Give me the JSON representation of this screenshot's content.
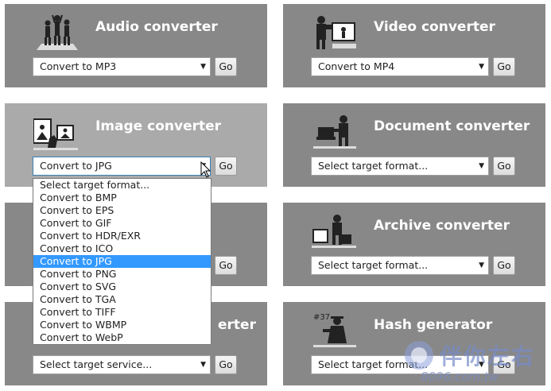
{
  "cards": [
    {
      "title": "Audio converter",
      "select": "Convert to MP3",
      "go": "Go",
      "icon": "musicians-icon"
    },
    {
      "title": "Video converter",
      "select": "Convert to MP4",
      "go": "Go",
      "icon": "video-camera-icon"
    },
    {
      "title": "Image converter",
      "select": "Convert to JPG",
      "go": "Go",
      "icon": "image-photographer-icon"
    },
    {
      "title": "Document converter",
      "select": "Select target format...",
      "go": "Go",
      "icon": "document-writer-icon"
    },
    {
      "title": "",
      "select": "",
      "go": "Go",
      "icon": ""
    },
    {
      "title": "Archive converter",
      "select": "Select target format...",
      "go": "Go",
      "icon": "archive-crate-icon"
    },
    {
      "title": "erter",
      "select": "Select target service...",
      "go": "Go",
      "icon": ""
    },
    {
      "title": "Hash generator",
      "select": "Select target format...",
      "go": "Go",
      "icon": "hash-detective-icon"
    }
  ],
  "dropdown": {
    "options": [
      "Select target format...",
      "Convert to BMP",
      "Convert to EPS",
      "Convert to GIF",
      "Convert to HDR/EXR",
      "Convert to ICO",
      "Convert to JPG",
      "Convert to PNG",
      "Convert to SVG",
      "Convert to TGA",
      "Convert to TIFF",
      "Convert to WBMP",
      "Convert to WebP"
    ],
    "selected": "Convert to JPG"
  },
  "watermark": {
    "text": "伴你左右",
    "url": "8096.com.tw"
  },
  "colors": {
    "card": "#888888",
    "card_highlight": "#aaaaaa",
    "selected": "#3399ff"
  }
}
